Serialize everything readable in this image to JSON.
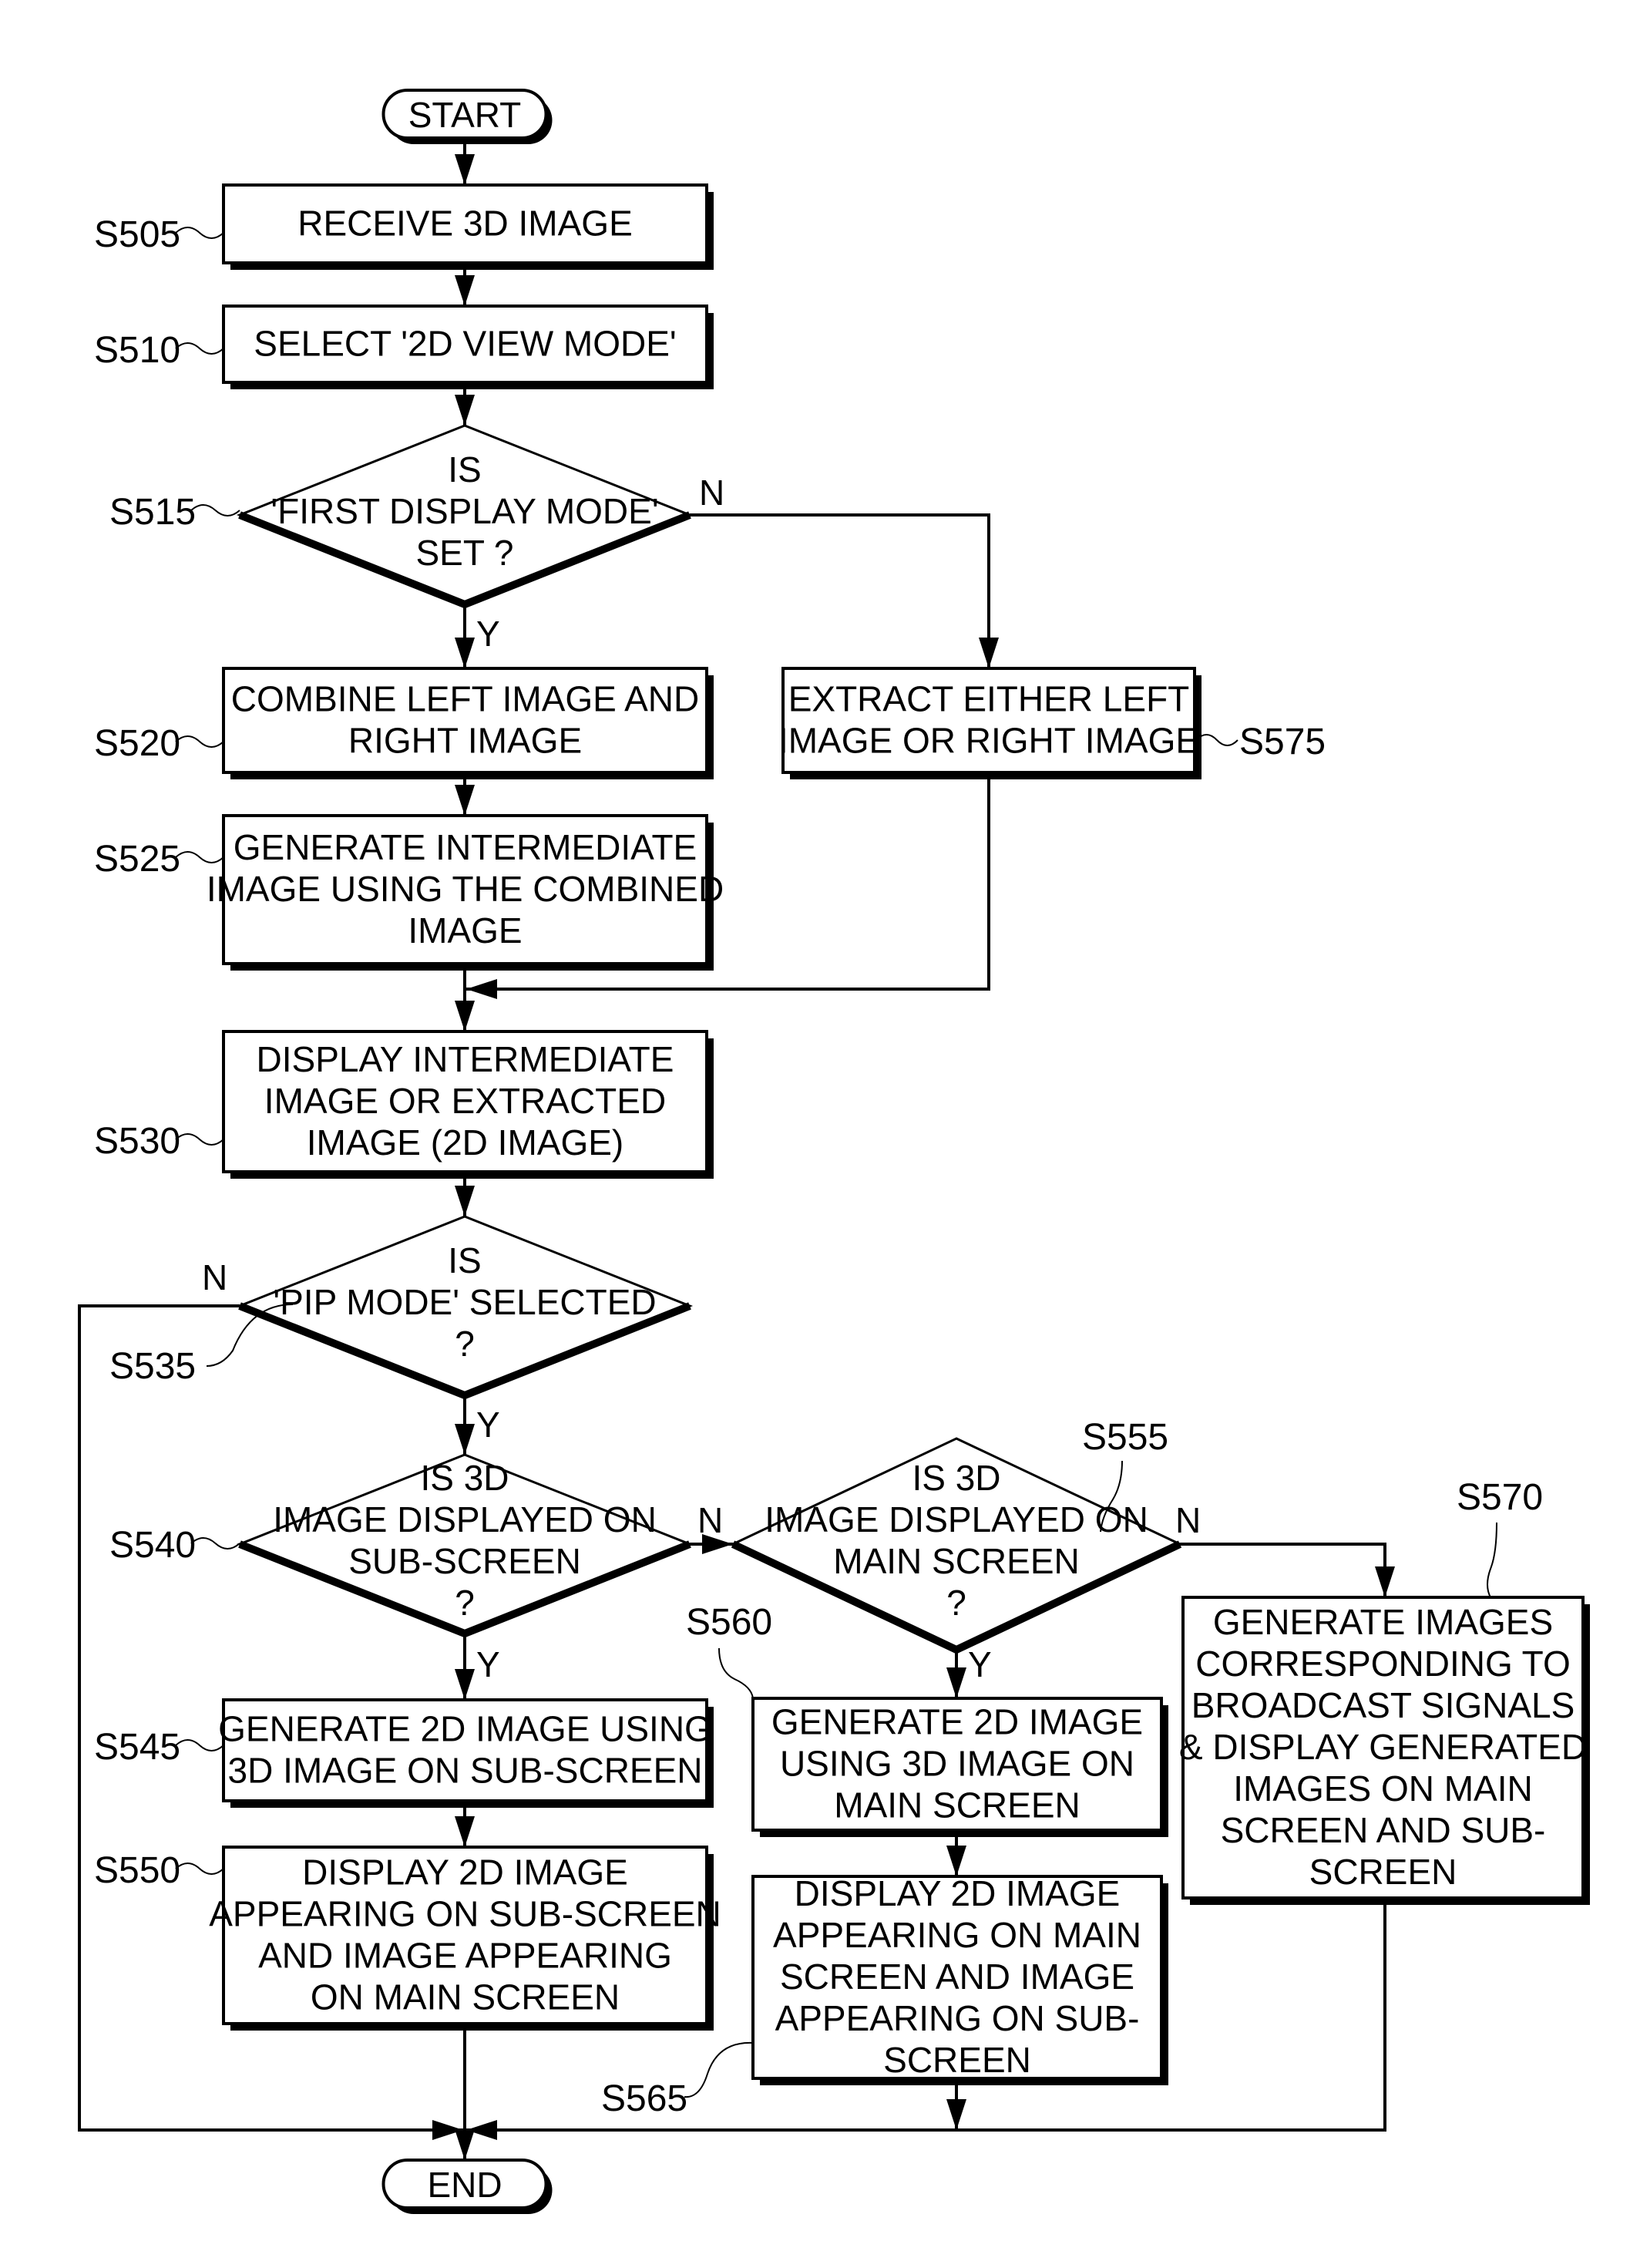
{
  "diagram": {
    "type": "flowchart",
    "terminals": {
      "start": "START",
      "end": "END"
    },
    "steps": {
      "S505": {
        "id": "S505",
        "shape": "process",
        "lines": [
          "RECEIVE 3D IMAGE"
        ]
      },
      "S510": {
        "id": "S510",
        "shape": "process",
        "lines": [
          "SELECT '2D VIEW MODE'"
        ]
      },
      "S515": {
        "id": "S515",
        "shape": "decision",
        "lines": [
          "IS",
          "'FIRST DISPLAY MODE'",
          "SET ?"
        ]
      },
      "S520": {
        "id": "S520",
        "shape": "process",
        "lines": [
          "COMBINE LEFT IMAGE AND",
          "RIGHT IMAGE"
        ]
      },
      "S525": {
        "id": "S525",
        "shape": "process",
        "lines": [
          "GENERATE INTERMEDIATE",
          "IMAGE USING THE COMBINED",
          "IMAGE"
        ]
      },
      "S575": {
        "id": "S575",
        "shape": "process",
        "lines": [
          "EXTRACT EITHER LEFT",
          "IMAGE OR RIGHT IMAGE"
        ]
      },
      "S530": {
        "id": "S530",
        "shape": "process",
        "lines": [
          "DISPLAY INTERMEDIATE",
          "IMAGE OR EXTRACTED",
          "IMAGE (2D IMAGE)"
        ]
      },
      "S535": {
        "id": "S535",
        "shape": "decision",
        "lines": [
          "IS",
          "'PIP MODE' SELECTED",
          "?"
        ]
      },
      "S540": {
        "id": "S540",
        "shape": "decision",
        "lines": [
          "IS 3D",
          "IMAGE DISPLAYED ON",
          "SUB-SCREEN",
          "?"
        ]
      },
      "S555": {
        "id": "S555",
        "shape": "decision",
        "lines": [
          "IS 3D",
          "IMAGE DISPLAYED ON",
          "MAIN SCREEN",
          "?"
        ]
      },
      "S545": {
        "id": "S545",
        "shape": "process",
        "lines": [
          "GENERATE 2D IMAGE USING",
          "3D IMAGE ON SUB-SCREEN"
        ]
      },
      "S550": {
        "id": "S550",
        "shape": "process",
        "lines": [
          "DISPLAY 2D IMAGE",
          "APPEARING ON SUB-SCREEN",
          "AND IMAGE APPEARING",
          "ON MAIN SCREEN"
        ]
      },
      "S560": {
        "id": "S560",
        "shape": "process",
        "lines": [
          "GENERATE 2D IMAGE",
          "USING 3D IMAGE ON",
          "MAIN SCREEN"
        ]
      },
      "S565": {
        "id": "S565",
        "shape": "process",
        "lines": [
          "DISPLAY 2D IMAGE",
          "APPEARING ON MAIN",
          "SCREEN AND IMAGE",
          "APPEARING ON SUB-",
          "SCREEN"
        ]
      },
      "S570": {
        "id": "S570",
        "shape": "process",
        "lines": [
          "GENERATE IMAGES",
          "CORRESPONDING TO",
          "BROADCAST SIGNALS",
          "& DISPLAY GENERATED",
          "IMAGES ON MAIN",
          "SCREEN AND SUB-",
          "SCREEN"
        ]
      }
    },
    "branch_labels": {
      "yes": "Y",
      "no": "N"
    },
    "edges": [
      {
        "from": "START",
        "to": "S505"
      },
      {
        "from": "S505",
        "to": "S510"
      },
      {
        "from": "S510",
        "to": "S515"
      },
      {
        "from": "S515",
        "to": "S520",
        "label": "Y"
      },
      {
        "from": "S515",
        "to": "S575",
        "label": "N"
      },
      {
        "from": "S520",
        "to": "S525"
      },
      {
        "from": "S525",
        "to": "S530"
      },
      {
        "from": "S575",
        "to": "S530"
      },
      {
        "from": "S530",
        "to": "S535"
      },
      {
        "from": "S535",
        "to": "S540",
        "label": "Y"
      },
      {
        "from": "S535",
        "to": "END",
        "label": "N"
      },
      {
        "from": "S540",
        "to": "S545",
        "label": "Y"
      },
      {
        "from": "S540",
        "to": "S555",
        "label": "N"
      },
      {
        "from": "S545",
        "to": "S550"
      },
      {
        "from": "S550",
        "to": "END"
      },
      {
        "from": "S555",
        "to": "S560",
        "label": "Y"
      },
      {
        "from": "S555",
        "to": "S570",
        "label": "N"
      },
      {
        "from": "S560",
        "to": "S565"
      },
      {
        "from": "S565",
        "to": "END"
      },
      {
        "from": "S570",
        "to": "END"
      }
    ]
  }
}
